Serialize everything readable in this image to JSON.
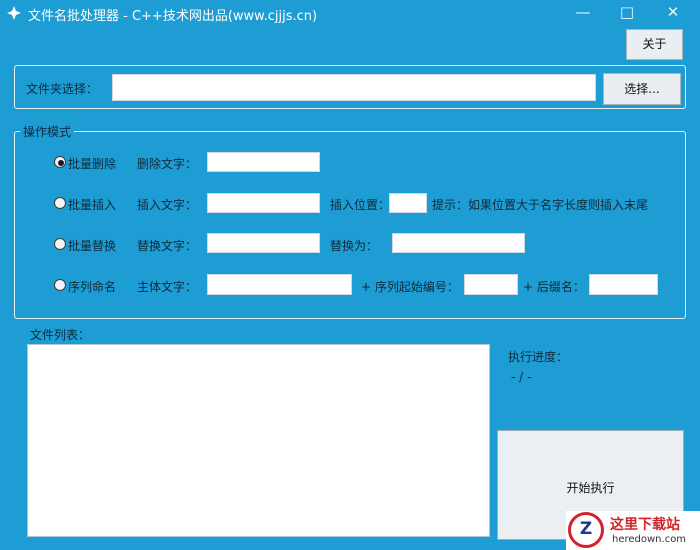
{
  "window": {
    "title": "文件名批处理器 - C++技术网出品(www.cjjjs.cn)"
  },
  "toolbar": {
    "about_label": "关于"
  },
  "folder": {
    "label": "文件夹选择：",
    "value": "",
    "browse_label": "选择..."
  },
  "mode_group": {
    "title": "操作模式",
    "rows": [
      {
        "option": "批量删除",
        "selected": true,
        "text_label": "删除文字："
      },
      {
        "option": "批量插入",
        "selected": false,
        "text_label": "插入文字：",
        "extra_label": "插入位置：",
        "hint": "提示：如果位置大于名字长度则插入末尾"
      },
      {
        "option": "批量替换",
        "selected": false,
        "text_label": "替换文字：",
        "extra_label": "替换为："
      },
      {
        "option": "序列命名",
        "selected": false,
        "text_label": "主体文字：",
        "extra_label": "+ 序列起始编号：",
        "extra2_label": "+ 后缀名："
      }
    ]
  },
  "file_list": {
    "label": "文件列表："
  },
  "progress": {
    "label": "执行进度：",
    "value": "- / -"
  },
  "execute": {
    "label": "开始执行"
  },
  "watermark": {
    "name": "这里下载站",
    "domain": "heredown.com"
  },
  "colors": {
    "window_bg": "#1e9cd4",
    "watermark_red": "#d2232a"
  },
  "icons": {
    "app": "app-icon",
    "minimize": "minimize-icon",
    "maximize": "maximize-icon",
    "close": "close-icon"
  }
}
